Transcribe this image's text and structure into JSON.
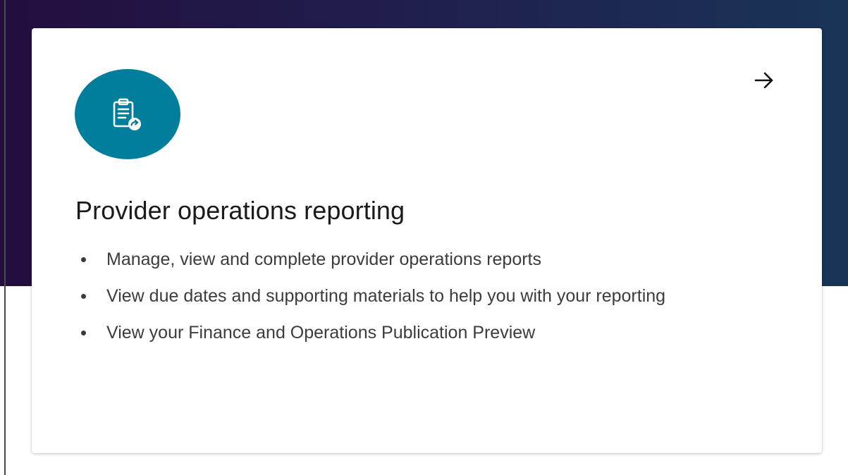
{
  "colors": {
    "hero_band_start": "#230e3e",
    "hero_band_end": "#193456",
    "icon_circle": "#007e9c",
    "title_text": "#1a1a1a",
    "body_text": "#3c3c3c"
  },
  "card": {
    "icon": "clipboard-report-icon",
    "arrow_icon": "arrow-right-icon",
    "title": "Provider operations reporting",
    "bullets": [
      "Manage, view and complete provider operations reports",
      "View due dates and supporting materials to help you with your reporting",
      "View your Finance and Operations Publication Preview"
    ]
  }
}
